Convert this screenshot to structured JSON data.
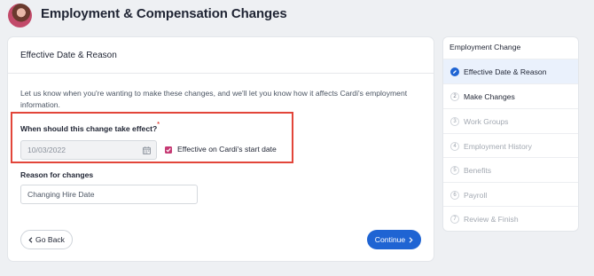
{
  "header": {
    "title": "Employment & Compensation Changes"
  },
  "card": {
    "title": "Effective Date & Reason",
    "intro": "Let us know when you're wanting to make these changes, and we'll let you know how it affects Cardi's employment information.",
    "question": "When should this change take effect?",
    "required_mark": "*",
    "date_value": "10/03/2022",
    "checkbox_label": "Effective on Cardi's start date",
    "checkbox_checked": true,
    "reason_label": "Reason for changes",
    "reason_value": "Changing Hire Date",
    "back_label": "Go Back",
    "continue_label": "Continue"
  },
  "sidebar": {
    "title": "Employment Change",
    "steps": [
      {
        "num": "1",
        "label": "Effective Date & Reason",
        "state": "active"
      },
      {
        "num": "2",
        "label": "Make Changes",
        "state": "next"
      },
      {
        "num": "3",
        "label": "Work Groups",
        "state": "disabled"
      },
      {
        "num": "4",
        "label": "Employment History",
        "state": "disabled"
      },
      {
        "num": "5",
        "label": "Benefits",
        "state": "disabled"
      },
      {
        "num": "6",
        "label": "Payroll",
        "state": "disabled"
      },
      {
        "num": "7",
        "label": "Review & Finish",
        "state": "disabled"
      }
    ]
  },
  "colors": {
    "accent": "#1f64d3",
    "checkbox": "#c63a74",
    "highlight": "#e2453a"
  }
}
